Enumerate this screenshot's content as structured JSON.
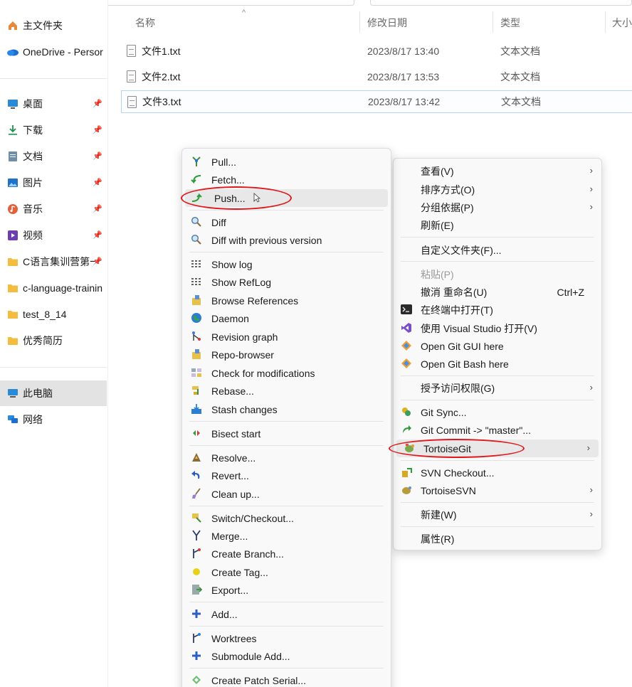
{
  "sidebar": {
    "items": [
      {
        "label": "主文件夹",
        "icon": "home-icon",
        "pinned": false
      },
      {
        "label": "OneDrive - Persor",
        "icon": "onedrive-cloud-icon",
        "pinned": false
      },
      {
        "label": "桌面",
        "icon": "desktop-icon",
        "pinned": true
      },
      {
        "label": "下载",
        "icon": "download-icon",
        "pinned": true
      },
      {
        "label": "文档",
        "icon": "document-icon",
        "pinned": true
      },
      {
        "label": "图片",
        "icon": "pictures-icon",
        "pinned": true
      },
      {
        "label": "音乐",
        "icon": "music-icon",
        "pinned": true
      },
      {
        "label": "视频",
        "icon": "videos-icon",
        "pinned": true
      },
      {
        "label": "C语言集训营第一",
        "icon": "folder-icon",
        "pinned": true
      },
      {
        "label": "c-language-trainin",
        "icon": "folder-icon",
        "pinned": false
      },
      {
        "label": "test_8_14",
        "icon": "folder-icon",
        "pinned": false
      },
      {
        "label": "优秀简历",
        "icon": "folder-icon",
        "pinned": false
      },
      {
        "label": "此电脑",
        "icon": "this-pc-icon",
        "pinned": false,
        "selected": true
      },
      {
        "label": "网络",
        "icon": "network-icon",
        "pinned": false
      }
    ]
  },
  "file_list": {
    "columns": [
      "名称",
      "修改日期",
      "类型",
      "大小"
    ],
    "rows": [
      {
        "name": "文件1.txt",
        "modified": "2023/8/17 13:40",
        "type": "文本文档"
      },
      {
        "name": "文件2.txt",
        "modified": "2023/8/17 13:53",
        "type": "文本文档"
      },
      {
        "name": "文件3.txt",
        "modified": "2023/8/17 13:42",
        "type": "文本文档",
        "selected": true
      }
    ]
  },
  "tortoisegit_menu": {
    "groups": [
      [
        "Pull...",
        "Fetch...",
        "Push..."
      ],
      [
        "Diff",
        "Diff with previous version"
      ],
      [
        "Show log",
        "Show RefLog",
        "Browse References",
        "Daemon",
        "Revision graph",
        "Repo-browser",
        "Check for modifications",
        "Rebase...",
        "Stash changes"
      ],
      [
        "Bisect start"
      ],
      [
        "Resolve...",
        "Revert...",
        "Clean up..."
      ],
      [
        "Switch/Checkout...",
        "Merge...",
        "Create Branch...",
        "Create Tag...",
        "Export..."
      ],
      [
        "Add..."
      ],
      [
        "Worktrees",
        "Submodule Add..."
      ],
      [
        "Create Patch Serial..."
      ]
    ],
    "highlighted": "Push..."
  },
  "context_menu": {
    "view": "查看(V)",
    "sort_by": "排序方式(O)",
    "group_by": "分组依据(P)",
    "refresh": "刷新(E)",
    "customize_folder": "自定义文件夹(F)...",
    "paste": "粘贴(P)",
    "undo_rename": "撤消 重命名(U)",
    "undo_shortcut": "Ctrl+Z",
    "open_in_terminal": "在终端中打开(T)",
    "open_with_vs": "使用 Visual Studio 打开(V)",
    "git_gui": "Open Git GUI here",
    "git_bash": "Open Git Bash here",
    "give_access": "授予访问权限(G)",
    "git_sync": "Git Sync...",
    "git_commit": "Git Commit -> \"master\"...",
    "tortoisegit": "TortoiseGit",
    "svn_checkout": "SVN Checkout...",
    "tortoisesvn": "TortoiseSVN",
    "new": "新建(W)",
    "properties": "属性(R)"
  },
  "colors": {
    "annotation_red": "#e0171b",
    "selection_border": "#b9d3ee",
    "menu_bg": "#f9f9f9"
  }
}
